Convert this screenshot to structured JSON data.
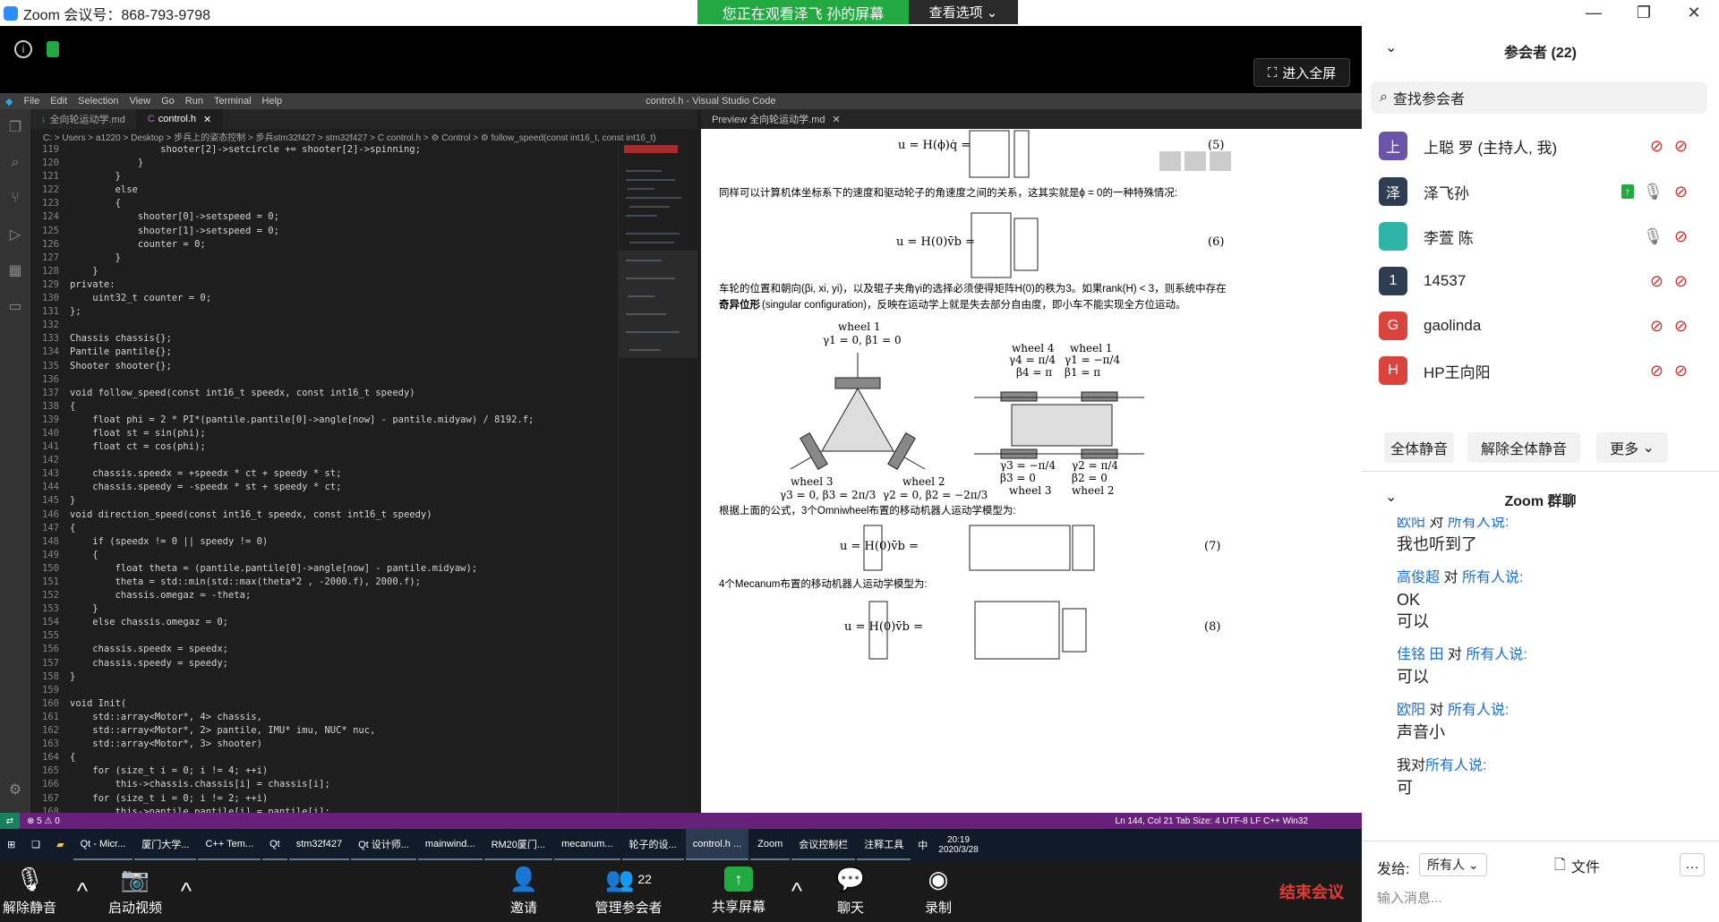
{
  "window": {
    "title": "Zoom 会议号：868-793-9798",
    "banner": "您正在观看泽飞 孙的屏幕",
    "view_options": "查看选项",
    "fullscreen": "进入全屏"
  },
  "vscode": {
    "menu": [
      "File",
      "Edit",
      "Selection",
      "View",
      "Go",
      "Run",
      "Terminal",
      "Help"
    ],
    "title": "control.h - Visual Studio Code",
    "tabs": [
      "全向轮运动学.md",
      "control.h"
    ],
    "breadcrumb": "C: > Users > a1220 > Desktop > 步兵上的姿态控制 > 步兵stm32f427 > stm32f427 > C control.h > ⚙ Control > ⚙ follow_speed(const int16_t, const int16_t)",
    "preview_tab": "Preview 全向轮运动学.md",
    "status_left": "⊗ 5 ⚠ 0",
    "status_right": "Ln 144, Col 21   Tab Size: 4   UTF-8   LF   C++   Win32",
    "code": [
      {
        "n": "119",
        "t": "                shooter[2]->setcircle += shooter[2]->spinning;"
      },
      {
        "n": "120",
        "t": "            }"
      },
      {
        "n": "121",
        "t": "        }"
      },
      {
        "n": "122",
        "t": "        else"
      },
      {
        "n": "123",
        "t": "        {"
      },
      {
        "n": "124",
        "t": "            shooter[0]->setspeed = 0;"
      },
      {
        "n": "125",
        "t": "            shooter[1]->setspeed = 0;"
      },
      {
        "n": "126",
        "t": "            counter = 0;"
      },
      {
        "n": "127",
        "t": "        }"
      },
      {
        "n": "128",
        "t": "    }"
      },
      {
        "n": "129",
        "t": "private:"
      },
      {
        "n": "130",
        "t": "    uint32_t counter = 0;"
      },
      {
        "n": "131",
        "t": "};"
      },
      {
        "n": "132",
        "t": ""
      },
      {
        "n": "133",
        "t": "Chassis chassis{};"
      },
      {
        "n": "134",
        "t": "Pantile pantile{};"
      },
      {
        "n": "135",
        "t": "Shooter shooter{};"
      },
      {
        "n": "136",
        "t": ""
      },
      {
        "n": "137",
        "t": "void follow_speed(const int16_t speedx, const int16_t speedy)"
      },
      {
        "n": "138",
        "t": "{"
      },
      {
        "n": "139",
        "t": "    float phi = 2 * PI*(pantile.pantile[0]->angle[now] - pantile.midyaw) / 8192.f;"
      },
      {
        "n": "140",
        "t": "    float st = sin(phi);"
      },
      {
        "n": "141",
        "t": "    float ct = cos(phi);"
      },
      {
        "n": "142",
        "t": ""
      },
      {
        "n": "143",
        "t": "    chassis.speedx = +speedx * ct + speedy * st;"
      },
      {
        "n": "144",
        "t": "    chassis.speedy = -speedx * st + speedy * ct;"
      },
      {
        "n": "145",
        "t": "}"
      },
      {
        "n": "146",
        "t": "void direction_speed(const int16_t speedx, const int16_t speedy)"
      },
      {
        "n": "147",
        "t": "{"
      },
      {
        "n": "148",
        "t": "    if (speedx != 0 || speedy != 0)"
      },
      {
        "n": "149",
        "t": "    {"
      },
      {
        "n": "150",
        "t": "        float theta = (pantile.pantile[0]->angle[now] - pantile.midyaw);"
      },
      {
        "n": "151",
        "t": "        theta = std::min(std::max(theta*2 , -2000.f), 2000.f);"
      },
      {
        "n": "152",
        "t": "        chassis.omegaz = -theta;"
      },
      {
        "n": "153",
        "t": "    }"
      },
      {
        "n": "154",
        "t": "    else chassis.omegaz = 0;"
      },
      {
        "n": "155",
        "t": ""
      },
      {
        "n": "156",
        "t": "    chassis.speedx = speedx;"
      },
      {
        "n": "157",
        "t": "    chassis.speedy = speedy;"
      },
      {
        "n": "158",
        "t": "}"
      },
      {
        "n": "159",
        "t": ""
      },
      {
        "n": "160",
        "t": "void Init("
      },
      {
        "n": "161",
        "t": "    std::array<Motor*, 4> chassis,"
      },
      {
        "n": "162",
        "t": "    std::array<Motor*, 2> pantile, IMU* imu, NUC* nuc,"
      },
      {
        "n": "163",
        "t": "    std::array<Motor*, 3> shooter)"
      },
      {
        "n": "164",
        "t": "{"
      },
      {
        "n": "165",
        "t": "    for (size_t i = 0; i != 4; ++i)"
      },
      {
        "n": "166",
        "t": "        this->chassis.chassis[i] = chassis[i];"
      },
      {
        "n": "167",
        "t": "    for (size_t i = 0; i != 2; ++i)"
      },
      {
        "n": "168",
        "t": "        this->pantile.pantile[i] = pantile[i];"
      }
    ],
    "preview": {
      "eq5": "u = H(ϕ)q̇ =",
      "eq5_no": "(5)",
      "p1": "同样可以计算机体坐标系下的速度和驱动轮子的角速度之间的关系，这其实就是ϕ = 0的一种特殊情况:",
      "eq6": "u = H(0)v̄b =",
      "eq6_no": "(6)",
      "p2": "车轮的位置和朝向(βi, xi, yi)，以及辊子夹角γi的选择必须使得矩阵H(0)的秩为3。如果rank(H) < 3，则系统中存在",
      "p2b_bold": "奇异位形",
      "p2b": "(singular configuration)，反映在运动学上就是失去部分自由度，即小车不能实现全方位运动。",
      "fig_labels": [
        "wheel 1",
        "γ1 = 0, β1 = 0",
        "wheel 3",
        "γ3 = 0, β3 = 2π/3",
        "wheel 2",
        "γ2 = 0, β2 = −2π/3",
        "wheel 4",
        "γ4 = π/4",
        "β4 = π",
        "wheel 1",
        "γ1 = −π/4",
        "β1 = π",
        "γ3 = −π/4",
        "β3 = 0",
        "wheel 3",
        "γ2 = π/4",
        "β2 = 0",
        "wheel 2"
      ],
      "p3": "根据上面的公式，3个Omniwheel布置的移动机器人运动学模型为:",
      "eq7": "u = H(0)v̄b =",
      "eq7_no": "(7)",
      "p4": "4个Mecanum布置的移动机器人运动学模型为:",
      "eq8": "u = H(0)v̄b =",
      "eq8_no": "(8)"
    }
  },
  "taskbar": [
    {
      "label": "Qt - Micr..."
    },
    {
      "label": "厦门大学..."
    },
    {
      "label": "C++ Tem..."
    },
    {
      "label": "Qt"
    },
    {
      "label": "stm32f427"
    },
    {
      "label": "Qt 设计师..."
    },
    {
      "label": "mainwind..."
    },
    {
      "label": "RM20厦门..."
    },
    {
      "label": "mecanum..."
    },
    {
      "label": "轮子的设..."
    },
    {
      "label": "control.h ..."
    },
    {
      "label": "Zoom"
    },
    {
      "label": "会议控制栏"
    },
    {
      "label": "注释工具"
    }
  ],
  "clock": {
    "time": "20:19",
    "date": "2020/3/28",
    "ime": "中"
  },
  "bottombar": {
    "unmute": "解除静音",
    "video": "启动视频",
    "invite": "邀请",
    "manage": "管理参会者",
    "count": "22",
    "share": "共享屏幕",
    "chat": "聊天",
    "record": "录制",
    "end": "结束会议"
  },
  "panel": {
    "title": "参会者 (22)",
    "search_placeholder": "查找参会者",
    "participants": [
      {
        "initial": "上",
        "name": "上聪 罗 (主持人, 我)",
        "color": "#6a54a8"
      },
      {
        "initial": "泽",
        "name": "泽飞孙",
        "color": "#2f3d52"
      },
      {
        "initial": "",
        "name": "李萱 陈",
        "color": "#2db6a8"
      },
      {
        "initial": "1",
        "name": "14537",
        "color": "#2f3d52"
      },
      {
        "initial": "G",
        "name": "gaolinda",
        "color": "#d9453d"
      },
      {
        "initial": "H",
        "name": "HP王向阳",
        "color": "#d9453d"
      }
    ],
    "mute_all": "全体静音",
    "unmute_all": "解除全体静音",
    "more": "更多",
    "chat_title": "Zoom 群聊",
    "chat": [
      {
        "from": "欧阳",
        "to": "所有人说:",
        "msgs": [
          "我也听到了"
        ]
      },
      {
        "from": "高俊超",
        "to": "所有人说:",
        "msgs": [
          "OK",
          "可以"
        ]
      },
      {
        "from": "佳铭 田",
        "to": "所有人说:",
        "msgs": [
          "可以"
        ]
      },
      {
        "from": "欧阳",
        "to": "所有人说:",
        "msgs": [
          "声音小"
        ]
      },
      {
        "from": "我对",
        "to": "所有人说:",
        "msgs": [
          "可"
        ]
      }
    ],
    "send_to_label": "发给:",
    "send_to": "所有人",
    "file": "文件",
    "input_placeholder": "输入消息..."
  }
}
